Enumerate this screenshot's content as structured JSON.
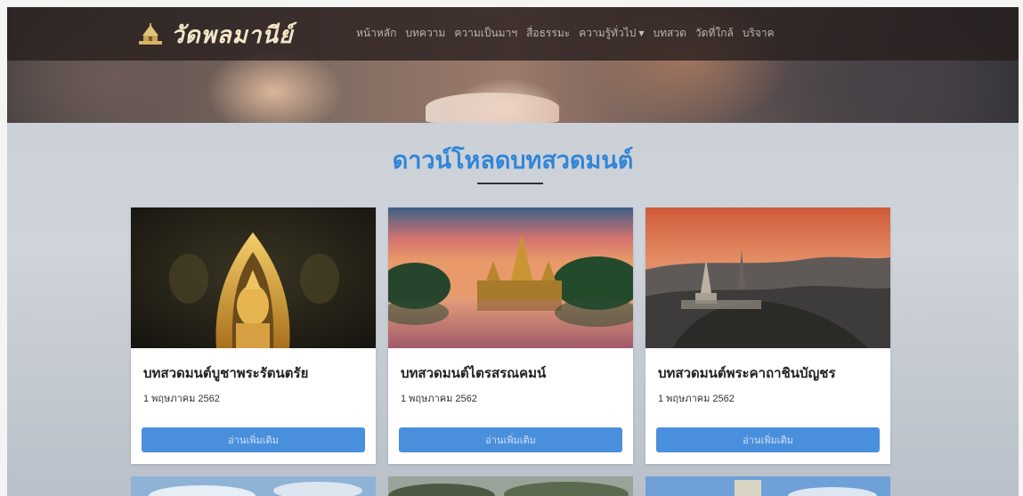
{
  "brand": {
    "logo_text": "วัดพลมานีย์",
    "logo_icon": "temple-icon"
  },
  "nav": {
    "items": [
      {
        "label": "หน้าหลัก",
        "dropdown": false
      },
      {
        "label": "บทความ",
        "dropdown": false
      },
      {
        "label": "ความเป็นมาฯ",
        "dropdown": false
      },
      {
        "label": "สื่อธรรมะ",
        "dropdown": false
      },
      {
        "label": "ความรู้ทั่วไป",
        "dropdown": true
      },
      {
        "label": "บทสวด",
        "dropdown": false
      },
      {
        "label": "วัดที่ใกล้",
        "dropdown": false
      },
      {
        "label": "บริจาค",
        "dropdown": false
      }
    ]
  },
  "section": {
    "title": "ดาวน์โหลดบทสวดมนต์"
  },
  "cards": [
    {
      "title": "บทสวดมนต์บูชาพระรัตนตรัย",
      "date": "1 พฤษภาคม 2562",
      "button": "อ่านเพิ่มเติม",
      "image": "golden-buddha-image"
    },
    {
      "title": "บทสวดมนต์ไตรสรณคมน์",
      "date": "1 พฤษภาคม 2562",
      "button": "อ่านเพิ่มเติม",
      "image": "temple-lake-sunset-image"
    },
    {
      "title": "บทสวดมนต์พระคาถาชินบัญชร",
      "date": "1 พฤษภาคม 2562",
      "button": "อ่านเพิ่มเติม",
      "image": "hilltop-pagoda-image"
    }
  ],
  "colors": {
    "accent": "#2f86d8",
    "button": "#4a8fdc",
    "navbar": "#261e1c"
  }
}
